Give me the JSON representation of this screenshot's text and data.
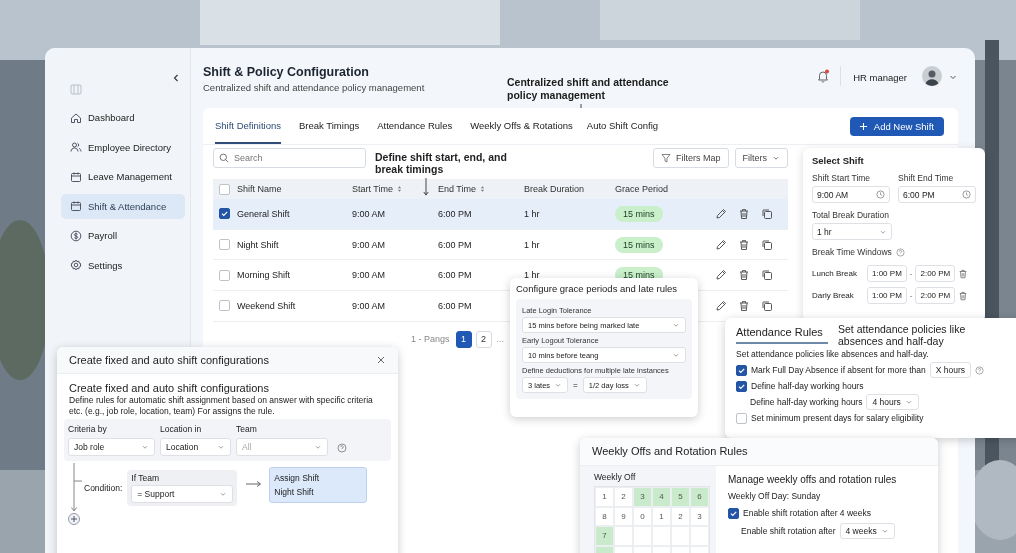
{
  "sidebar": {
    "items": [
      {
        "label": "Dashboard",
        "selected": false
      },
      {
        "label": "Employee Directory",
        "selected": false
      },
      {
        "label": "Leave Management",
        "selected": false
      },
      {
        "label": "Shift & Attendance",
        "selected": true
      },
      {
        "label": "Payroll",
        "selected": false
      },
      {
        "label": "Settings",
        "selected": false
      }
    ]
  },
  "header": {
    "title": "Shift & Policy Configuration",
    "subtitle": "Centralized shift and attendance policy management",
    "annotation": "Centralized shift and attendance policy management",
    "user": "HR manager",
    "unread_notifications": true
  },
  "tabs": [
    {
      "label": "Shift Definitions",
      "selected": true
    },
    {
      "label": "Break Timings",
      "selected": false
    },
    {
      "label": "Attendance Rules",
      "selected": false
    },
    {
      "label": "Weekly Offs & Rotations",
      "selected": false
    },
    {
      "label": "Auto Shift Config",
      "selected": false
    }
  ],
  "add_button": "Add New Shift",
  "search": {
    "placeholder": "Search"
  },
  "table_annotation": "Define shift start, end, and break timings",
  "filter_buttons": [
    {
      "label": "Filters Map",
      "kind": "filter"
    },
    {
      "label": "Filters",
      "kind": "dropdown"
    }
  ],
  "table": {
    "all_checked": false,
    "columns": [
      {
        "label": "Shift Name",
        "sortable": false
      },
      {
        "label": "Start Time",
        "sortable": true
      },
      {
        "label": "End Time",
        "sortable": true
      },
      {
        "label": "Break Duration",
        "sortable": false
      },
      {
        "label": "Grace Period",
        "sortable": false
      }
    ],
    "rows": [
      {
        "selected": true,
        "name": "General Shift",
        "start": "9:00 AM",
        "end": "6:00 PM",
        "break": "1 hr",
        "grace": "15 mins"
      },
      {
        "selected": false,
        "name": "Night Shift",
        "start": "9:00 AM",
        "end": "6:00 PM",
        "break": "1 hr",
        "grace": "15 mins"
      },
      {
        "selected": false,
        "name": "Morning Shift",
        "start": "9:00 AM",
        "end": "6:00 PM",
        "break": "1 hr",
        "grace": "15 mins"
      },
      {
        "selected": false,
        "name": "Weekend Shift",
        "start": "9:00 AM",
        "end": "6:00 PM"
      }
    ]
  },
  "pagination": {
    "summary": "1 - Pangs",
    "pages": [
      {
        "label": "1",
        "selected": true
      },
      {
        "label": "2",
        "selected": false
      }
    ],
    "more": "..."
  },
  "select_shift": {
    "title": "Select Shift",
    "start_label": "Shift Start Time",
    "start": "9:00 AM",
    "end_label": "Shift End Time",
    "end": "6:00 PM",
    "break_label": "Total Break Duration",
    "break": "1 hr",
    "windows_label": "Break Time Windows",
    "separator": "-",
    "windows": [
      {
        "name": "Lunch Break",
        "from": "1:00 PM",
        "to": "2:00 PM"
      },
      {
        "name": "Darly Break",
        "from": "1:00 PM",
        "to": "2:00 PM"
      }
    ]
  },
  "grace_card": {
    "title": "Configure grace periods and late rules",
    "fields": [
      {
        "label": "Late Login Tolerance",
        "value": "15 mins before being marked late"
      },
      {
        "label": "Early Logout Tolerance",
        "value": "10 mins before teang"
      }
    ],
    "deduction_label": "Define deductions for multiple late instances",
    "lates": "3 lates",
    "equals": "=",
    "loss": "1/2 day loss"
  },
  "attendance_card": {
    "title": "Attendance Rules",
    "note": "Set attendance policies like absences and half-day",
    "description": "Set attendance policies like absences and half-day.",
    "rules": [
      {
        "kind": "check",
        "label": "Mark Full Day Absence if absent for more than",
        "checked": true,
        "value": "X hours",
        "help": true
      },
      {
        "kind": "check",
        "label": "Define half-day working hours",
        "checked": true
      },
      {
        "kind": "select",
        "label": "Define half-day working hours",
        "value": "4 hours"
      },
      {
        "kind": "check",
        "label": "Set minimum present days for salary eligibility",
        "checked": false
      }
    ]
  },
  "weekly_card": {
    "title": "Weekly Offs and Rotation Rules",
    "calendar_label": "Weekly Off",
    "calendar": [
      [
        {
          "label": "1",
          "selected": false
        },
        {
          "label": "2",
          "selected": false
        },
        {
          "label": "3",
          "selected": true
        },
        {
          "label": "4",
          "selected": true
        },
        {
          "label": "5",
          "selected": true
        },
        {
          "label": "6",
          "selected": true
        }
      ],
      [
        {
          "label": "8",
          "selected": false
        },
        {
          "label": "9",
          "selected": false
        },
        {
          "label": "0",
          "selected": false
        },
        {
          "label": "1",
          "selected": false
        },
        {
          "label": "2",
          "selected": false
        },
        {
          "label": "3",
          "selected": false
        }
      ],
      [
        {
          "label": "7",
          "selected": true
        },
        {
          "selected": false
        },
        {
          "selected": false
        },
        {
          "selected": false
        },
        {
          "selected": false
        },
        {
          "selected": false
        }
      ],
      [
        {
          "selected": true
        },
        {
          "selected": false
        },
        {
          "selected": false
        },
        {
          "selected": false
        },
        {
          "selected": false
        },
        {
          "selected": false
        }
      ]
    ],
    "heading": "Manage weekly offs and rotation rules",
    "off_day": "Weekly Off Day: Sunday",
    "rotation_label": "Enable shift rotation after 4 weeks",
    "rotation_checked": true,
    "rotation_select_label": "Enable shift rotation after",
    "rotation_value": "4 weeks"
  },
  "auto_card": {
    "title": "Create fixed and auto shift configurations",
    "heading": "Create fixed and auto shift configurations",
    "description": "Define rules for automatic shift assignment based on answer with specific criteria etc. (e.g., job role, location, team) For assigns the rule.",
    "criteria": [
      {
        "label": "Criteria by",
        "value": "Job role"
      },
      {
        "label": "Location in",
        "value": "Location"
      },
      {
        "label": "Team",
        "placeholder": "All"
      }
    ],
    "condition_label": "Condition:",
    "condition": {
      "label": "If Team",
      "value": "= Support"
    },
    "result": [
      "Assign Shift",
      "Night Shift"
    ]
  }
}
